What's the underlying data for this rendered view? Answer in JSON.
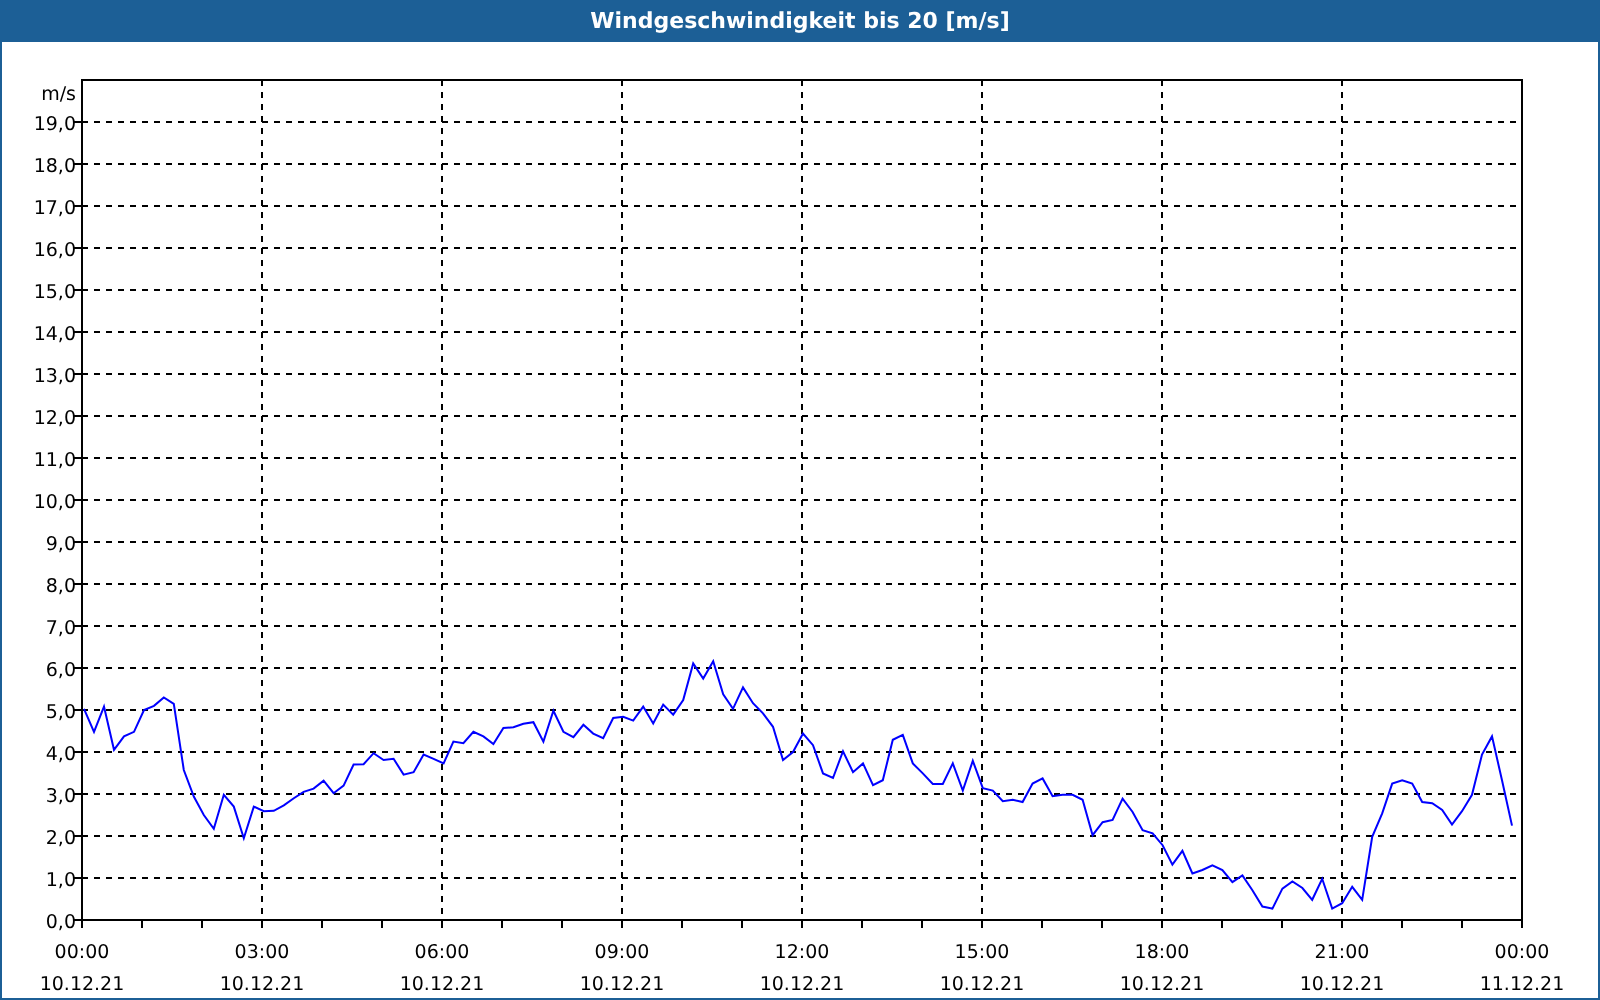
{
  "chart_data": {
    "type": "line",
    "title": "Windgeschwindigkeit bis 20 [m/s]",
    "ylabel": "m/s",
    "ylim": [
      0,
      20
    ],
    "grid": true,
    "yticks": [
      {
        "value": 0,
        "label": "0,0"
      },
      {
        "value": 1,
        "label": "1,0"
      },
      {
        "value": 2,
        "label": "2,0"
      },
      {
        "value": 3,
        "label": "3,0"
      },
      {
        "value": 4,
        "label": "4,0"
      },
      {
        "value": 5,
        "label": "5,0"
      },
      {
        "value": 6,
        "label": "6,0"
      },
      {
        "value": 7,
        "label": "7,0"
      },
      {
        "value": 8,
        "label": "8,0"
      },
      {
        "value": 9,
        "label": "9,0"
      },
      {
        "value": 10,
        "label": "10,0"
      },
      {
        "value": 11,
        "label": "11,0"
      },
      {
        "value": 12,
        "label": "12,0"
      },
      {
        "value": 13,
        "label": "13,0"
      },
      {
        "value": 14,
        "label": "14,0"
      },
      {
        "value": 15,
        "label": "15,0"
      },
      {
        "value": 16,
        "label": "16,0"
      },
      {
        "value": 17,
        "label": "17,0"
      },
      {
        "value": 18,
        "label": "18,0"
      },
      {
        "value": 19,
        "label": "19,0"
      }
    ],
    "categories": [
      "00:00\n10.12.21",
      null,
      null,
      null,
      null,
      null,
      null,
      null,
      null,
      null,
      null,
      null,
      null,
      null,
      null,
      null,
      null,
      null,
      "03:00\n10.12.21",
      null,
      null,
      null,
      null,
      null,
      null,
      null,
      null,
      null,
      null,
      null,
      null,
      null,
      null,
      null,
      null,
      null,
      "06:00\n10.12.21",
      null,
      null,
      null,
      null,
      null,
      null,
      null,
      null,
      null,
      null,
      null,
      null,
      null,
      null,
      null,
      null,
      null,
      "09:00\n10.12.21",
      null,
      null,
      null,
      null,
      null,
      null,
      null,
      null,
      null,
      null,
      null,
      null,
      null,
      null,
      null,
      null,
      null,
      "12:00\n10.12.21",
      null,
      null,
      null,
      null,
      null,
      null,
      null,
      null,
      null,
      null,
      null,
      null,
      null,
      null,
      null,
      null,
      null,
      "15:00\n10.12.21",
      null,
      null,
      null,
      null,
      null,
      null,
      null,
      null,
      null,
      null,
      null,
      null,
      null,
      null,
      null,
      null,
      null,
      "18:00\n10.12.21",
      null,
      null,
      null,
      null,
      null,
      null,
      null,
      null,
      null,
      null,
      null,
      null,
      null,
      null,
      null,
      null,
      null,
      "21:00\n10.12.21",
      null,
      null,
      null,
      null,
      null,
      null,
      null,
      null,
      null,
      null,
      null,
      null,
      null,
      null,
      null,
      null,
      null,
      "00:00\n11.12.21"
    ],
    "series": [
      {
        "color": "#0000ff",
        "values": [
          5.03,
          4.48,
          5.08,
          4.05,
          4.37,
          4.48,
          5.0,
          5.1,
          5.3,
          5.15,
          3.57,
          2.94,
          2.5,
          2.17,
          2.98,
          2.7,
          1.95,
          2.7,
          2.59,
          2.6,
          2.73,
          2.9,
          3.05,
          3.13,
          3.32,
          3.02,
          3.2,
          3.7,
          3.71,
          3.97,
          3.81,
          3.84,
          3.46,
          3.52,
          3.94,
          3.84,
          3.73,
          4.25,
          4.21,
          4.48,
          4.37,
          4.19,
          4.57,
          4.59,
          4.67,
          4.71,
          4.25,
          4.98,
          4.48,
          4.35,
          4.65,
          4.44,
          4.33,
          4.81,
          4.84,
          4.75,
          5.08,
          4.68,
          5.13,
          4.89,
          5.24,
          6.11,
          5.75,
          6.16,
          5.37,
          5.03,
          5.54,
          5.16,
          4.92,
          4.6,
          3.81,
          4.0,
          4.44,
          4.16,
          3.49,
          3.38,
          4.02,
          3.52,
          3.73,
          3.21,
          3.33,
          4.29,
          4.41,
          3.73,
          3.49,
          3.24,
          3.24,
          3.73,
          3.08,
          3.79,
          3.14,
          3.08,
          2.83,
          2.86,
          2.81,
          3.25,
          3.37,
          2.95,
          2.98,
          2.98,
          2.86,
          2.02,
          2.33,
          2.38,
          2.89,
          2.57,
          2.14,
          2.06,
          1.78,
          1.32,
          1.65,
          1.11,
          1.19,
          1.3,
          1.19,
          0.9,
          1.06,
          0.71,
          0.32,
          0.27,
          0.75,
          0.92,
          0.76,
          0.48,
          0.98,
          0.27,
          0.4,
          0.79,
          0.48,
          1.98,
          2.54,
          3.25,
          3.33,
          3.25,
          2.81,
          2.78,
          2.62,
          2.27,
          2.59,
          2.98,
          3.94,
          4.37,
          3.33,
          2.25,
          null
        ]
      }
    ]
  }
}
